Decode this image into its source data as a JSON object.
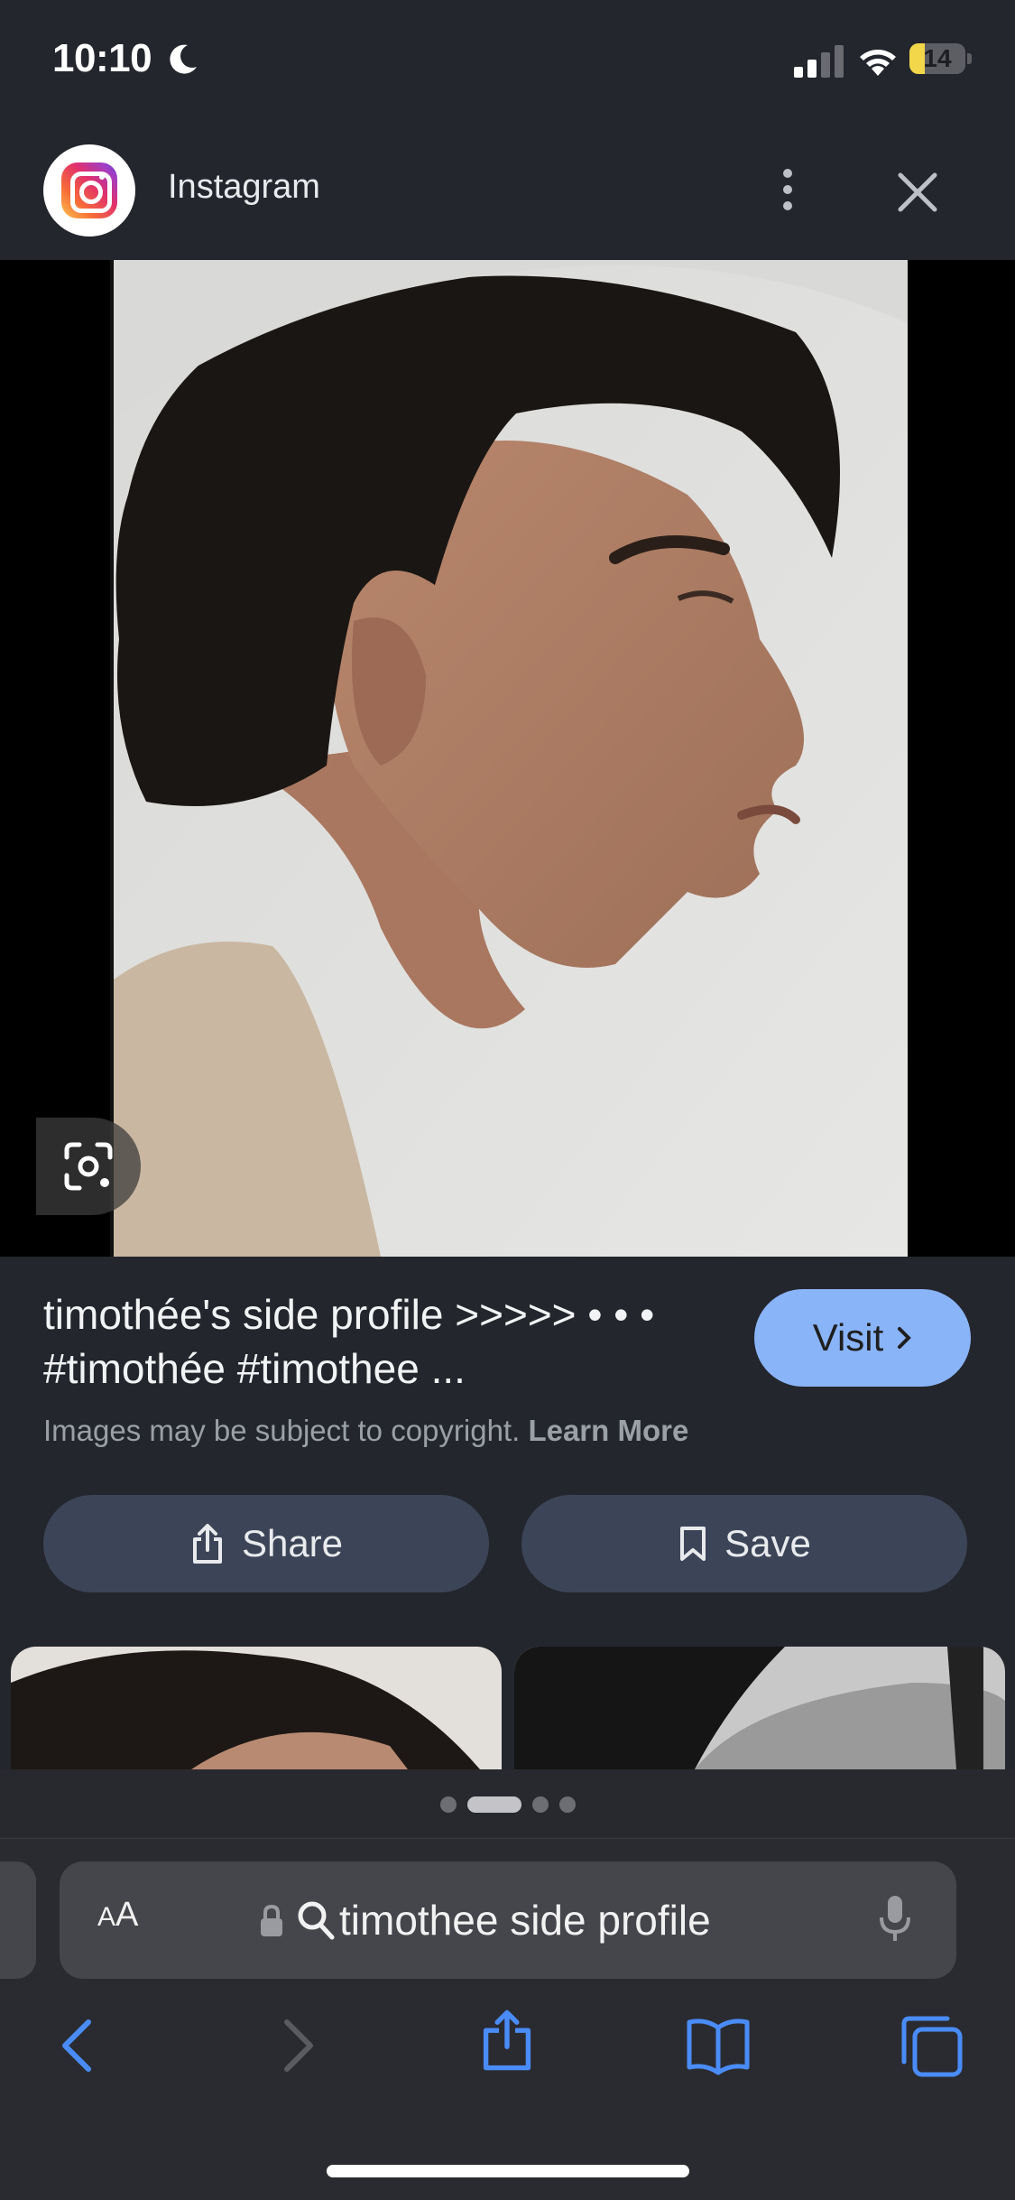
{
  "status_bar": {
    "time": "10:10",
    "battery_level": "14",
    "battery_percent": 14
  },
  "header": {
    "source": "Instagram"
  },
  "result": {
    "caption_line1": "timothée's side profile >>>>> • • •",
    "caption_line2": "#timothée #timothee ...",
    "visit_label": "Visit",
    "copyright_text": "Images may be subject to copyright.",
    "learn_more_label": "Learn More",
    "share_label": "Share",
    "save_label": "Save"
  },
  "pager": {
    "active_index": 1,
    "count": 4
  },
  "safari": {
    "aa_label_small": "A",
    "aa_label_large": "A",
    "query": "timothee side profile"
  },
  "colors": {
    "accent": "#8ab4f8",
    "toolbar_icon": "#4a8cf7",
    "button_bg": "#3c4558"
  }
}
